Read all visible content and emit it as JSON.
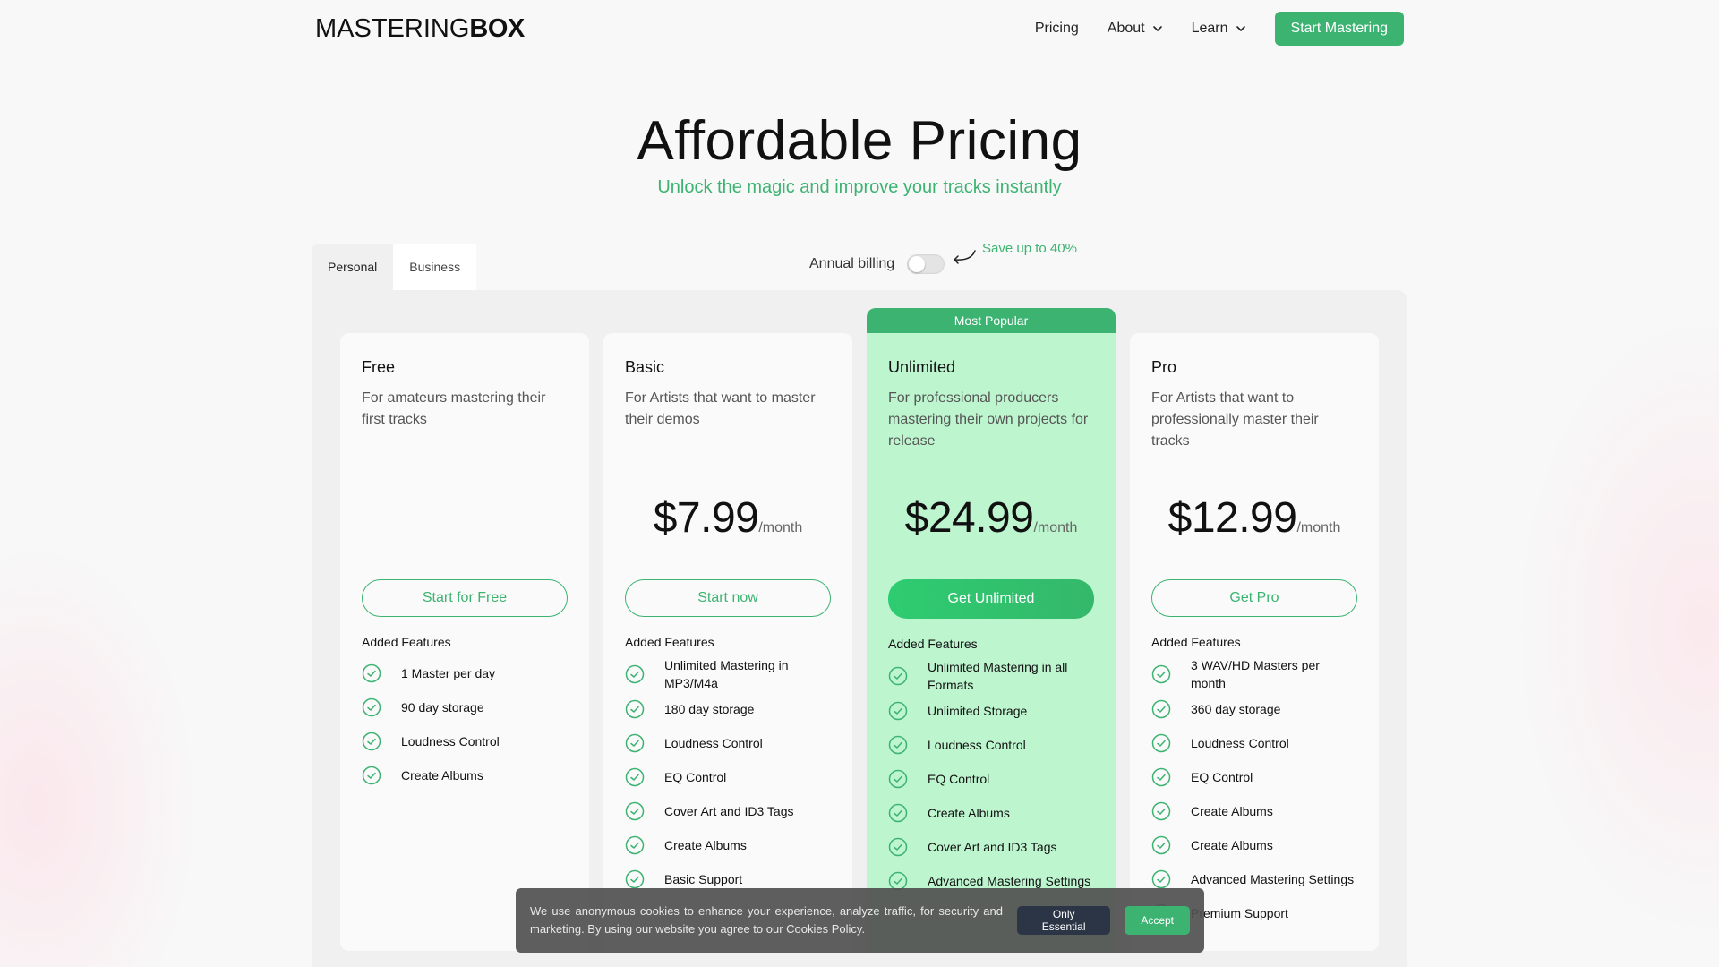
{
  "nav": {
    "logo_thin": "MASTERING",
    "logo_bold": "BOX",
    "links": [
      {
        "label": "Pricing"
      },
      {
        "label": "About"
      },
      {
        "label": "Learn"
      }
    ],
    "cta": "Start Mastering"
  },
  "hero": {
    "title": "Affordable Pricing",
    "subtitle": "Unlock the magic and improve your tracks instantly"
  },
  "tabs": [
    {
      "label": "Personal",
      "active": true
    },
    {
      "label": "Business",
      "active": false
    }
  ],
  "billing": {
    "label": "Annual billing",
    "enabled": false,
    "save_note": "Save up to 40%"
  },
  "colors": {
    "accent": "#3cb371",
    "popular_bg": "#bdf5cf"
  },
  "plans": [
    {
      "name": "Free",
      "desc": "For amateurs mastering their first tracks",
      "price": "",
      "per": "",
      "cta": "Start for Free",
      "features_title": "Added Features",
      "features": [
        "1 Master per day",
        "90 day storage",
        "Loudness Control",
        "Create Albums"
      ]
    },
    {
      "name": "Basic",
      "desc": "For Artists that want to master their demos",
      "price": "$7.99",
      "per": "/month",
      "cta": "Start now",
      "features_title": "Added Features",
      "features": [
        "Unlimited Mastering in MP3/M4a",
        "180 day storage",
        "Loudness Control",
        "EQ Control",
        "Cover Art and ID3 Tags",
        "Create Albums",
        "Basic Support"
      ]
    },
    {
      "name": "Unlimited",
      "badge": "Most Popular",
      "desc": "For professional producers mastering their own projects for release",
      "price": "$24.99",
      "per": "/month",
      "cta": "Get Unlimited",
      "features_title": "Added Features",
      "features": [
        "Unlimited Mastering in all Formats",
        "Unlimited Storage",
        "Loudness Control",
        "EQ Control",
        "Create Albums",
        "Cover Art and ID3 Tags",
        "Advanced Mastering Settings"
      ]
    },
    {
      "name": "Pro",
      "desc": "For Artists that want to professionally master their tracks",
      "price": "$12.99",
      "per": "/month",
      "cta": "Get Pro",
      "features_title": "Added Features",
      "features": [
        "3 WAV/HD Masters per month",
        "360 day storage",
        "Loudness Control",
        "EQ Control",
        "Create Albums",
        "Create Albums",
        "Advanced Mastering Settings",
        "Premium Support"
      ]
    }
  ],
  "cookie": {
    "text": "We use anonymous cookies to enhance your experience, analyze traffic, for security and marketing. By using our website you agree to our Cookies Policy.",
    "essential": "Only Essential",
    "accept": "Accept"
  }
}
